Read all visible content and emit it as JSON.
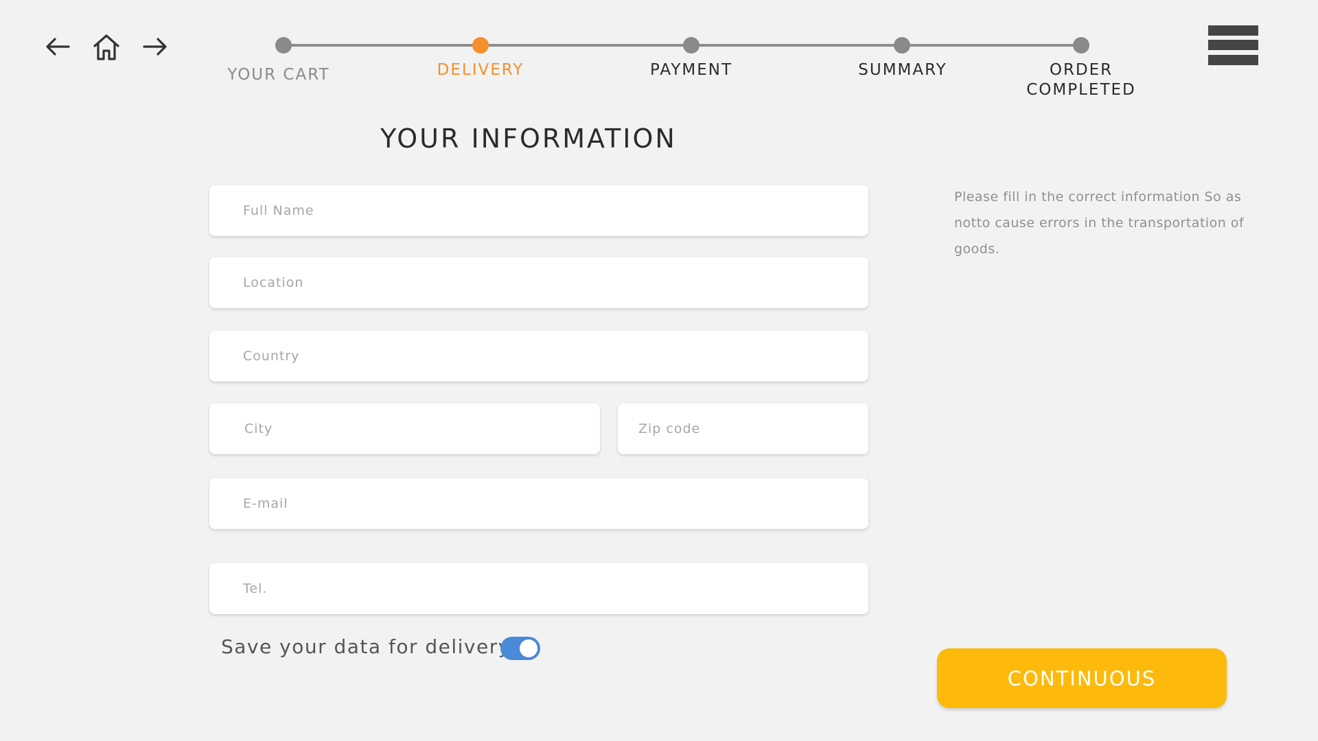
{
  "nav": {
    "back_icon": "arrow-left-icon",
    "home_icon": "home-icon",
    "forward_icon": "arrow-right-icon",
    "menu_icon": "hamburger-menu-icon"
  },
  "steps": [
    {
      "label": "YOUR CART",
      "state": "done"
    },
    {
      "label": "DELIVERY",
      "state": "current"
    },
    {
      "label": "PAYMENT",
      "state": "upcoming"
    },
    {
      "label": "SUMMARY",
      "state": "upcoming"
    },
    {
      "label": "ORDER\nCOMPLETED",
      "state": "upcoming"
    }
  ],
  "title": "YOUR INFORMATION",
  "form": {
    "full_name": {
      "placeholder": "Full Name",
      "value": ""
    },
    "location": {
      "placeholder": "Location",
      "value": ""
    },
    "country": {
      "placeholder": "Country",
      "value": ""
    },
    "city": {
      "placeholder": "City",
      "value": ""
    },
    "zip": {
      "placeholder": "Zip code",
      "value": ""
    },
    "email": {
      "placeholder": "E-mail",
      "value": ""
    },
    "tel": {
      "placeholder": "Tel.",
      "value": ""
    }
  },
  "hint": "Please fill in the correct information So as notto cause errors in the transportation of goods.",
  "save_data": {
    "label": "Save your data for delivery",
    "enabled": true
  },
  "continue_label": "CONTINUOUS",
  "colors": {
    "accent": "#f6902c",
    "button": "#fdba0c",
    "toggle": "#4a8ad8",
    "background": "#f2f2f2"
  }
}
